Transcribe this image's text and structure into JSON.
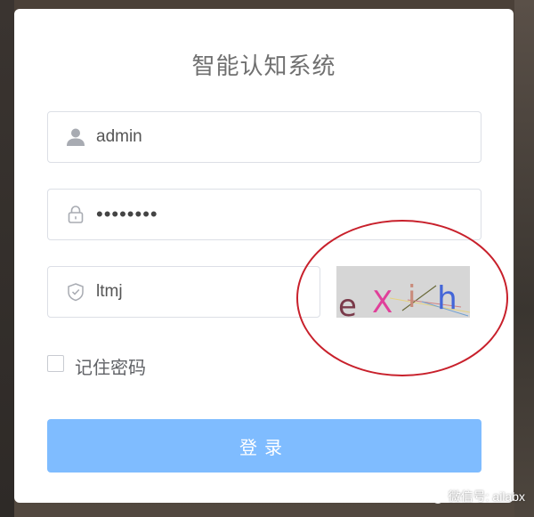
{
  "title": "智能认知系统",
  "username": {
    "value": "admin",
    "icon": "user-icon"
  },
  "password": {
    "value": "••••••••",
    "icon": "lock-icon"
  },
  "captcha_input": {
    "value": "ltmj",
    "icon": "shield-icon"
  },
  "captcha_image": {
    "chars": [
      "e",
      "X",
      "i",
      "h"
    ],
    "colors": [
      "#7a3a4a",
      "#e0409a",
      "#c98a7a",
      "#4466d8"
    ]
  },
  "remember": {
    "label": "记住密码",
    "checked": false
  },
  "login_button": {
    "label": "登录",
    "color": "#7fbcff"
  },
  "watermark": {
    "text": "微信号: ailabx"
  },
  "annotation_color": "#c8202b"
}
